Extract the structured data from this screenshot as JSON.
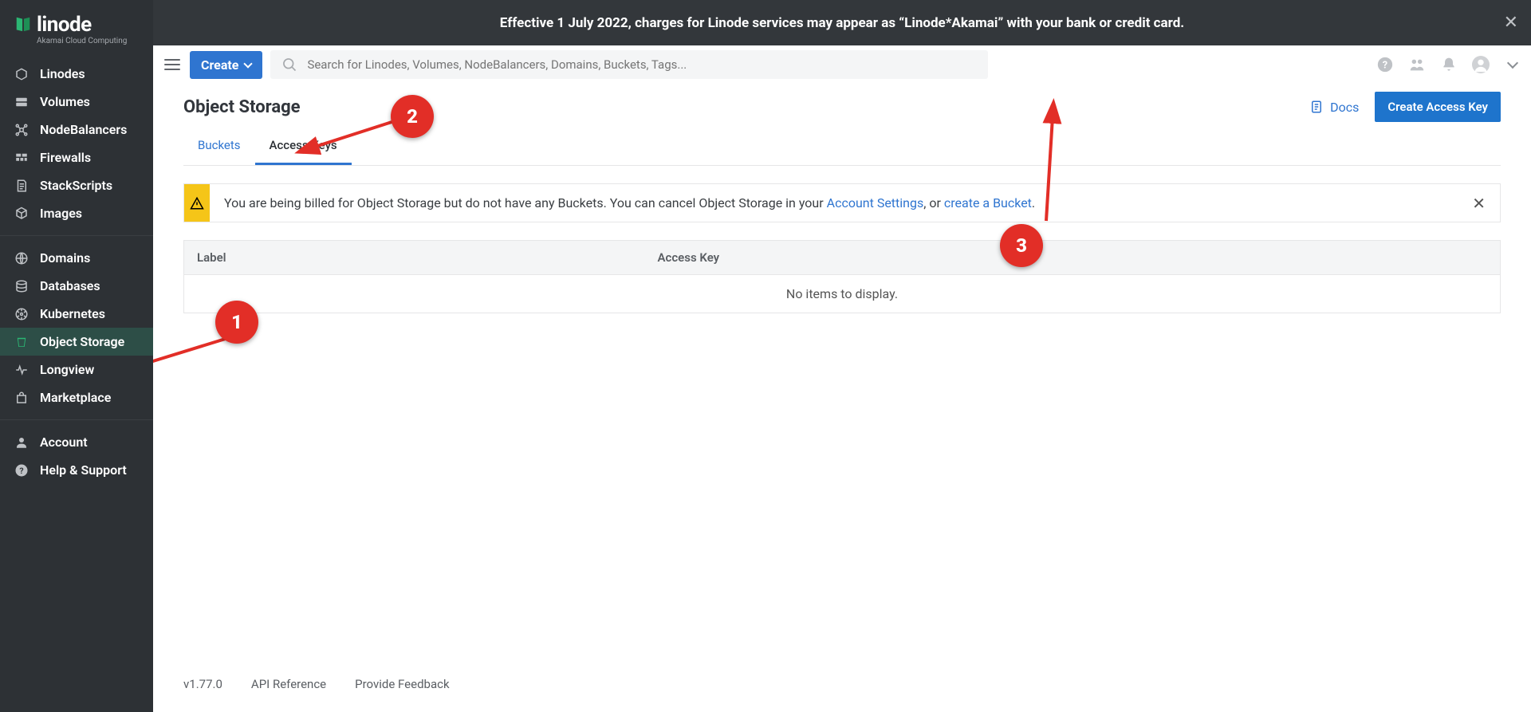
{
  "brand": {
    "name": "linode",
    "tagline": "Akamai Cloud Computing"
  },
  "banner": {
    "text": "Effective 1 July 2022, charges for Linode services may appear as “Linode*Akamai” with your bank or credit card."
  },
  "topbar": {
    "create_label": "Create",
    "search_placeholder": "Search for Linodes, Volumes, NodeBalancers, Domains, Buckets, Tags..."
  },
  "sidebar": {
    "group1": [
      {
        "label": "Linodes",
        "icon": "cube"
      },
      {
        "label": "Volumes",
        "icon": "disk"
      },
      {
        "label": "NodeBalancers",
        "icon": "balance"
      },
      {
        "label": "Firewalls",
        "icon": "wall"
      },
      {
        "label": "StackScripts",
        "icon": "script"
      },
      {
        "label": "Images",
        "icon": "image"
      }
    ],
    "group2": [
      {
        "label": "Domains",
        "icon": "globe"
      },
      {
        "label": "Databases",
        "icon": "database"
      },
      {
        "label": "Kubernetes",
        "icon": "wheel"
      },
      {
        "label": "Object Storage",
        "icon": "bucket",
        "active": true
      },
      {
        "label": "Longview",
        "icon": "pulse"
      },
      {
        "label": "Marketplace",
        "icon": "bag"
      }
    ],
    "group3": [
      {
        "label": "Account",
        "icon": "user"
      },
      {
        "label": "Help & Support",
        "icon": "help"
      }
    ]
  },
  "page": {
    "title": "Object Storage",
    "docs_label": "Docs",
    "primary_action": "Create Access Key",
    "tabs": {
      "buckets": "Buckets",
      "access_keys": "Access Keys",
      "active": "access_keys"
    },
    "alert": {
      "pre": "You are being billed for Object Storage but do not have any Buckets. You can cancel Object Storage in your ",
      "link1": "Account Settings",
      "mid": ", or ",
      "link2": "create a Bucket",
      "post": "."
    },
    "table": {
      "columns": {
        "label": "Label",
        "access_key": "Access Key"
      },
      "empty": "No items to display."
    }
  },
  "footer": {
    "version": "v1.77.0",
    "api_ref": "API Reference",
    "feedback": "Provide Feedback"
  },
  "annotations": {
    "step1": "1",
    "step2": "2",
    "step3": "3"
  }
}
